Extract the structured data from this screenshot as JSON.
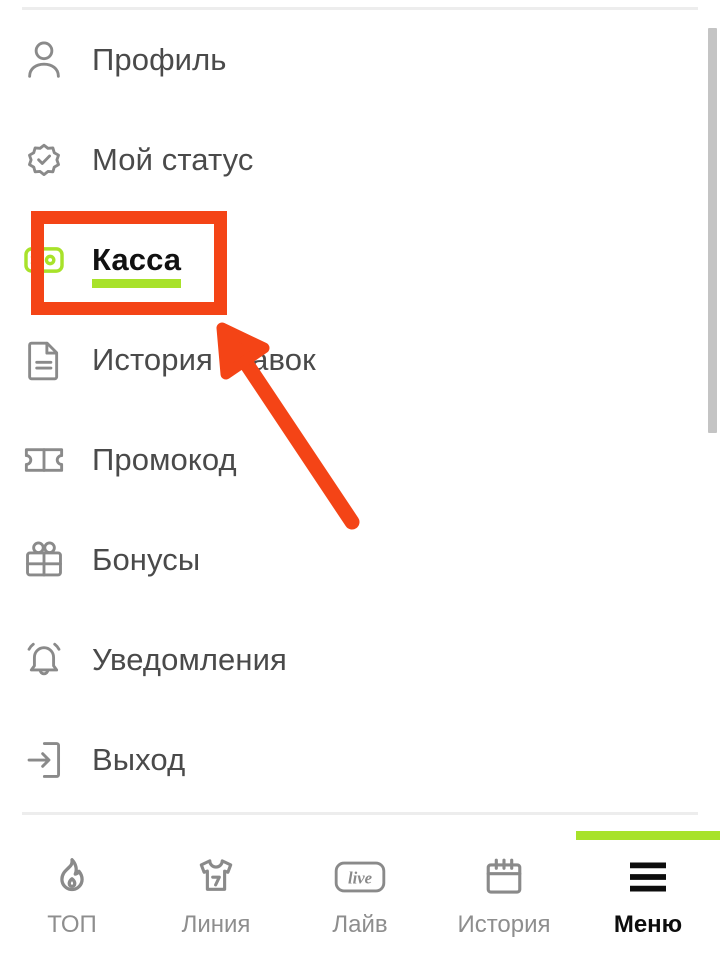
{
  "app": {
    "language": "ru",
    "accent_green": "#a8e22a",
    "annotation_red": "#f44416",
    "text_gray": "#4a4a4a",
    "text_black": "#111111"
  },
  "menu": {
    "items": [
      {
        "id": "profile",
        "label": "Профиль",
        "icon": "user-icon",
        "active": false
      },
      {
        "id": "my-status",
        "label": "Мой статус",
        "icon": "verified-badge-icon",
        "active": false
      },
      {
        "id": "cashier",
        "label": "Касса",
        "icon": "wallet-icon",
        "active": true
      },
      {
        "id": "bet-history",
        "label": "История ставок",
        "icon": "document-icon",
        "active": false
      },
      {
        "id": "promo-code",
        "label": "Промокод",
        "icon": "ticket-icon",
        "active": false
      },
      {
        "id": "bonuses",
        "label": "Бонусы",
        "icon": "gift-icon",
        "active": false
      },
      {
        "id": "notifications",
        "label": "Уведомления",
        "icon": "bell-icon",
        "active": false
      },
      {
        "id": "logout",
        "label": "Выход",
        "icon": "exit-icon",
        "active": false
      }
    ]
  },
  "tabbar": {
    "tabs": [
      {
        "id": "top",
        "label": "ТОП",
        "icon": "flame-icon",
        "active": false
      },
      {
        "id": "line",
        "label": "Линия",
        "icon": "jersey-7-icon",
        "active": false
      },
      {
        "id": "live",
        "label": "Лайв",
        "icon": "live-icon",
        "active": false
      },
      {
        "id": "history",
        "label": "История",
        "icon": "calendar-icon",
        "active": false
      },
      {
        "id": "menu",
        "label": "Меню",
        "icon": "hamburger-icon",
        "active": true
      }
    ]
  },
  "annotations": {
    "highlight_target": "Касса",
    "rect_color": "#f44416",
    "arrow_color": "#f44416"
  },
  "scrollbar": {
    "position": "right",
    "thumb_fraction": "0.50"
  }
}
